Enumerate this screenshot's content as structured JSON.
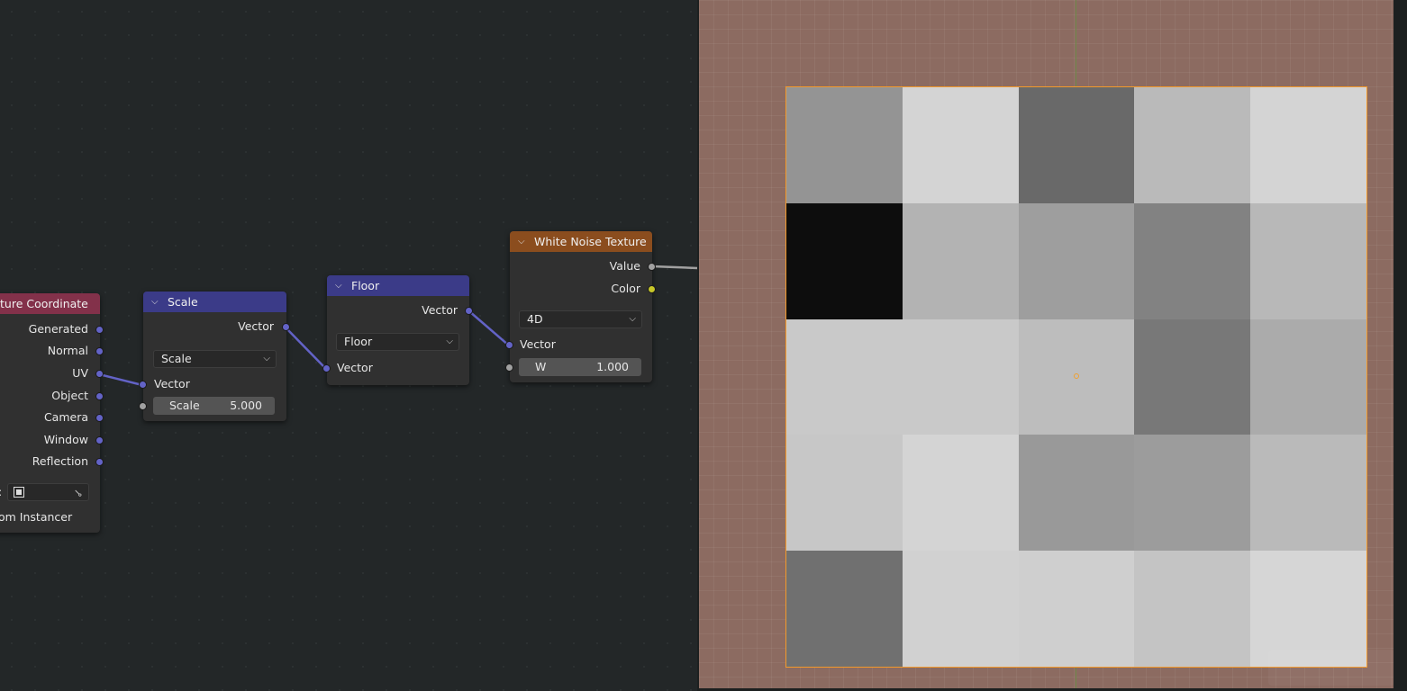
{
  "colors": {
    "editor_bg": "#232728",
    "node_body": "#303030",
    "header_input": "#83314a",
    "header_vector": "#3b3b88",
    "header_texture": "#8b4d1e",
    "socket_vector": "#6363c7",
    "socket_float": "#a1a1a1",
    "socket_color": "#c7c729",
    "viewport_bg": "#8c6b61",
    "selection_outline": "#f39a2c"
  },
  "nodes": {
    "texture_coordinate": {
      "title": "ture Coordinate",
      "outputs": [
        "Generated",
        "Normal",
        "UV",
        "Object",
        "Camera",
        "Window",
        "Reflection"
      ],
      "object_label": ":",
      "object_icon": "object-picker-icon",
      "eyedropper_icon": "eyedropper-icon",
      "instancer_label": "om Instancer"
    },
    "scale": {
      "title": "Scale",
      "output": "Vector",
      "operation": "Scale",
      "input_vector": "Vector",
      "scale_label": "Scale",
      "scale_value": "5.000"
    },
    "floor": {
      "title": "Floor",
      "output": "Vector",
      "operation": "Floor",
      "input_vector": "Vector"
    },
    "white_noise": {
      "title": "White Noise Texture",
      "output_value": "Value",
      "output_color": "Color",
      "dimensions": "4D",
      "input_vector": "Vector",
      "w_label": "W",
      "w_value": "1.000"
    }
  },
  "viewport": {
    "grid_values": [
      [
        0.58,
        0.83,
        0.41,
        0.73,
        0.83
      ],
      [
        0.05,
        0.7,
        0.62,
        0.51,
        0.72
      ],
      [
        0.79,
        0.79,
        0.74,
        0.47,
        0.67
      ],
      [
        0.78,
        0.83,
        0.6,
        0.61,
        0.73
      ],
      [
        0.44,
        0.82,
        0.81,
        0.77,
        0.84
      ]
    ]
  }
}
